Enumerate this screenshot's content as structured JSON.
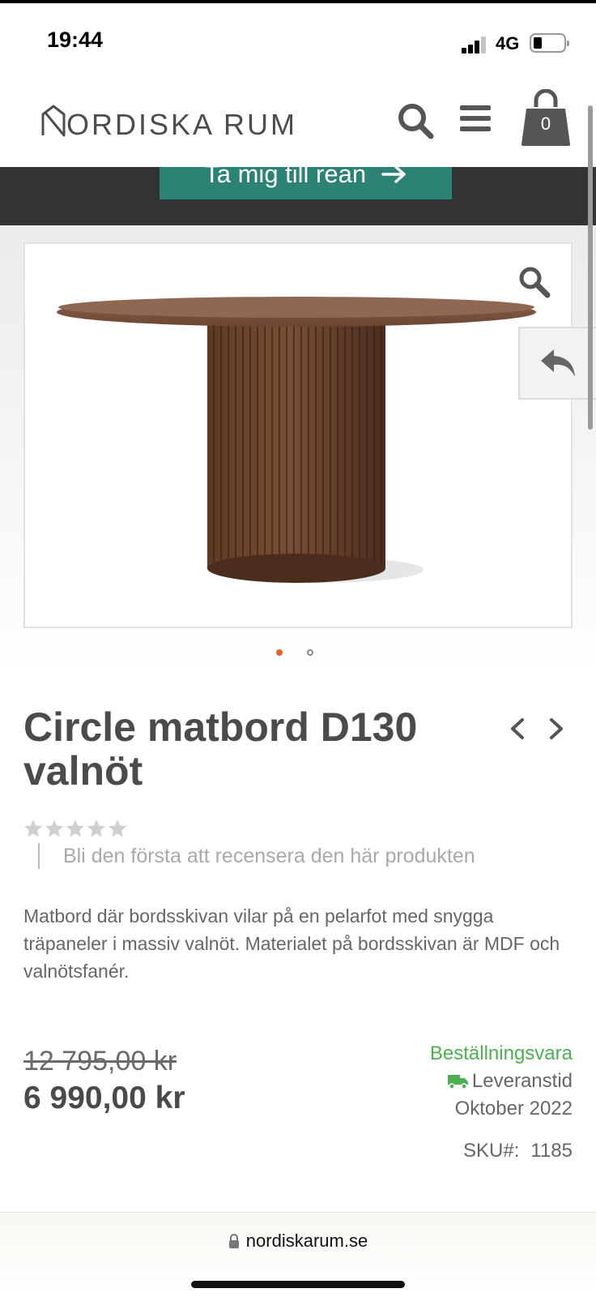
{
  "status_bar": {
    "time": "19:44",
    "network": "4G",
    "icons": [
      "signal-icon",
      "battery-icon"
    ]
  },
  "header": {
    "logo_text": "NORDISKA RUM",
    "icons": [
      "search-icon",
      "menu-icon",
      "cart-icon"
    ],
    "cart_count": "0"
  },
  "promo": {
    "button_label": "Ta mig till rean"
  },
  "gallery": {
    "icons": [
      "zoom-icon",
      "back-arrow-icon"
    ],
    "active_slide": 1,
    "slide_count": 2,
    "accent_color": "#e8622a"
  },
  "product": {
    "title": "Circle matbord D130 valnöt",
    "rating": 0,
    "rating_max": 5,
    "review_prompt": "Bli den första att recensera den här produkten",
    "description": "Matbord där bordsskivan vilar på en pelarfot med snygga träpaneler i massiv valnöt. Materialet på bordsskivan är MDF och valnötsfanér.",
    "old_price": "12 795,00 kr",
    "price": "6 990,00 kr",
    "availability": "Beställningsvara",
    "availability_color": "#4caf50",
    "delivery_label": "Leveranstid",
    "delivery_date": "Oktober 2022",
    "sku_label": "SKU#:",
    "sku_value": "1185"
  },
  "browser": {
    "url": "nordiskarum.se"
  },
  "colors": {
    "promo_button": "#2c8275",
    "promo_strip": "#333333",
    "text_dark": "#4b4b4b"
  }
}
